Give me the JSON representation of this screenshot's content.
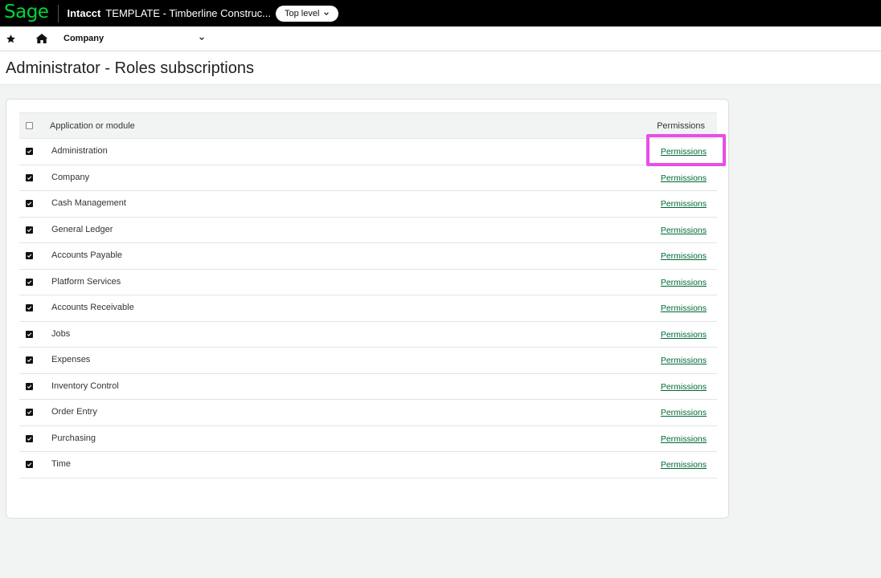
{
  "header": {
    "logo": "Sage",
    "product": "Intacct",
    "company": "TEMPLATE - Timberline Construc...",
    "level_button": "Top level"
  },
  "nav": {
    "company_menu": "Company"
  },
  "page": {
    "title": "Administrator - Roles subscriptions"
  },
  "table": {
    "col_app": "Application or module",
    "col_permissions": "Permissions",
    "rows": [
      {
        "module": "Administration",
        "link": "Permissions",
        "checked": true
      },
      {
        "module": "Company",
        "link": "Permissions",
        "checked": true
      },
      {
        "module": "Cash Management",
        "link": "Permissions",
        "checked": true
      },
      {
        "module": "General Ledger",
        "link": "Permissions",
        "checked": true
      },
      {
        "module": "Accounts Payable",
        "link": "Permissions",
        "checked": true
      },
      {
        "module": "Platform Services",
        "link": "Permissions",
        "checked": true
      },
      {
        "module": "Accounts Receivable",
        "link": "Permissions",
        "checked": true
      },
      {
        "module": "Jobs",
        "link": "Permissions",
        "checked": true
      },
      {
        "module": "Expenses",
        "link": "Permissions",
        "checked": true
      },
      {
        "module": "Inventory Control",
        "link": "Permissions",
        "checked": true
      },
      {
        "module": "Order Entry",
        "link": "Permissions",
        "checked": true
      },
      {
        "module": "Purchasing",
        "link": "Permissions",
        "checked": true
      },
      {
        "module": "Time",
        "link": "Permissions",
        "checked": true
      }
    ]
  },
  "colors": {
    "brand": "#00d639",
    "link": "#006837",
    "highlight": "#e84ee8"
  },
  "icons": [
    "star-icon",
    "home-icon",
    "chevron-down-icon",
    "checkmark-icon"
  ]
}
